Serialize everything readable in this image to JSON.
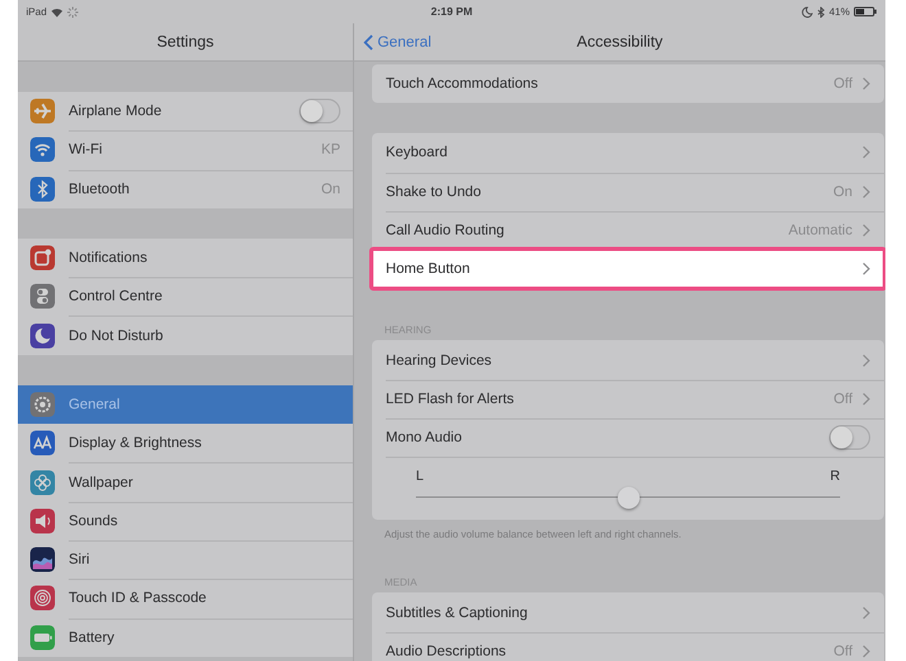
{
  "status_bar": {
    "device": "iPad",
    "time": "2:19 PM",
    "battery": "41%"
  },
  "sidebar": {
    "title": "Settings",
    "groups": [
      {
        "items": [
          {
            "label": "Airplane Mode",
            "kind": "toggle",
            "on": false,
            "selected": false
          },
          {
            "label": "Wi-Fi",
            "kind": "link",
            "value": "KP",
            "selected": false
          },
          {
            "label": "Bluetooth",
            "kind": "link",
            "value": "On",
            "selected": false
          }
        ]
      },
      {
        "items": [
          {
            "label": "Notifications",
            "kind": "link",
            "selected": false
          },
          {
            "label": "Control Centre",
            "kind": "link",
            "selected": false
          },
          {
            "label": "Do Not Disturb",
            "kind": "link",
            "selected": false
          }
        ]
      },
      {
        "items": [
          {
            "label": "General",
            "kind": "link",
            "selected": true
          },
          {
            "label": "Display & Brightness",
            "kind": "link",
            "selected": false
          },
          {
            "label": "Wallpaper",
            "kind": "link",
            "selected": false
          },
          {
            "label": "Sounds",
            "kind": "link",
            "selected": false
          },
          {
            "label": "Siri",
            "kind": "link",
            "selected": false
          },
          {
            "label": "Touch ID & Passcode",
            "kind": "link",
            "selected": false
          },
          {
            "label": "Battery",
            "kind": "link",
            "selected": false
          }
        ]
      }
    ]
  },
  "detail": {
    "back": "General",
    "title": "Accessibility",
    "groups": [
      {
        "rows": [
          {
            "kind": "link",
            "label": "Touch Accommodations",
            "value": "Off",
            "highlighted": false
          }
        ]
      },
      {
        "rows": [
          {
            "kind": "link",
            "label": "Keyboard",
            "highlighted": false
          },
          {
            "kind": "link",
            "label": "Shake to Undo",
            "value": "On",
            "highlighted": false
          },
          {
            "kind": "link",
            "label": "Call Audio Routing",
            "value": "Automatic",
            "highlighted": false
          },
          {
            "kind": "link",
            "label": "Home Button",
            "highlighted": true
          }
        ]
      },
      {
        "header": "HEARING",
        "rows": [
          {
            "kind": "link",
            "label": "Hearing Devices",
            "highlighted": false
          },
          {
            "kind": "link",
            "label": "LED Flash for Alerts",
            "value": "Off",
            "highlighted": false
          },
          {
            "kind": "toggle",
            "label": "Mono Audio",
            "on": false,
            "highlighted": false
          },
          {
            "kind": "slider",
            "left": "L",
            "right": "R",
            "level": 0.5
          }
        ],
        "footer": "Adjust the audio volume balance between left and right channels."
      },
      {
        "header": "MEDIA",
        "rows": [
          {
            "kind": "link",
            "label": "Subtitles & Captioning",
            "highlighted": false
          },
          {
            "kind": "link",
            "label": "Audio Descriptions",
            "value": "Off",
            "highlighted": false
          }
        ]
      }
    ]
  }
}
